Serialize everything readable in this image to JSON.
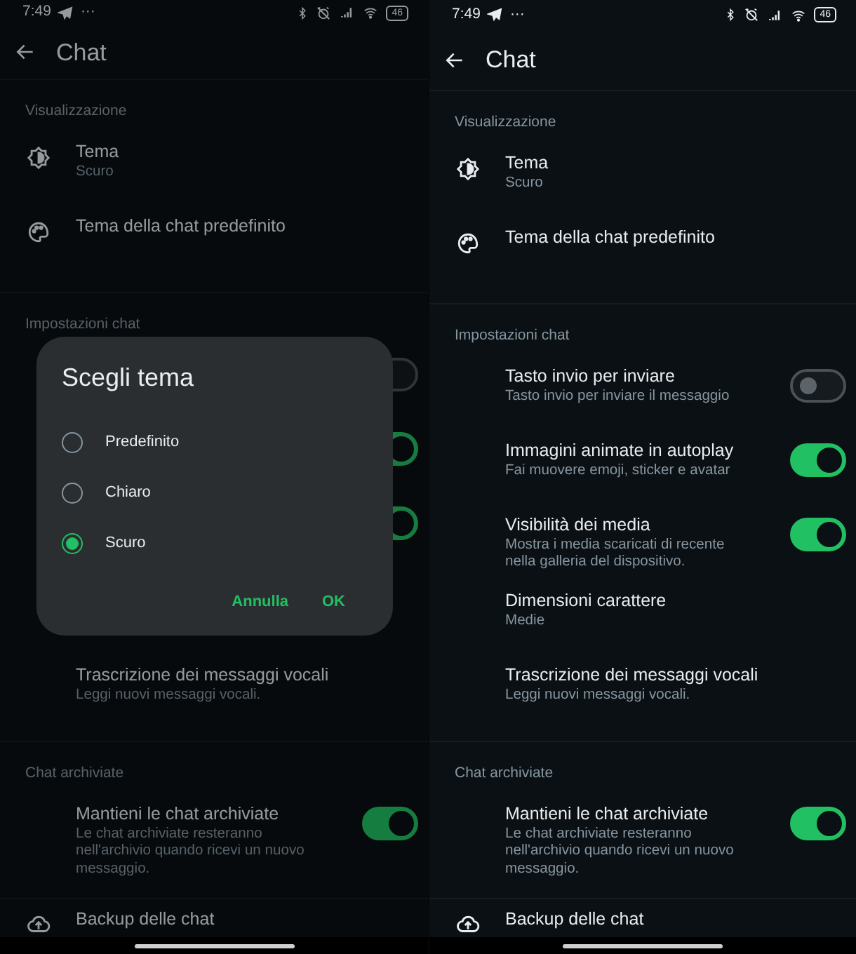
{
  "screens": [
    {
      "status_bar": {
        "time": "7:49",
        "more": "···",
        "battery": "46"
      },
      "title": "Chat",
      "sections": [
        {
          "header": "Visualizzazione",
          "items": [
            {
              "kind": "theme",
              "title": "Tema",
              "subtitle": "Scuro"
            },
            {
              "kind": "palette",
              "title": "Tema della chat predefinito"
            }
          ]
        },
        {
          "header": "Impostazioni chat",
          "items": [
            {
              "kind": "toggle",
              "on": false
            },
            {
              "kind": "toggle",
              "on": true
            },
            {
              "kind": "toggle",
              "on": true
            },
            {
              "kind": "text",
              "title": "Trascrizione dei messaggi vocali",
              "subtitle": "Leggi nuovi messaggi vocali."
            }
          ]
        },
        {
          "header": "Chat archiviate",
          "items": [
            {
              "kind": "toggle",
              "title": "Mantieni le chat archiviate",
              "subtitle": "Le chat archiviate resteranno nell'archivio quando ricevi un nuovo messaggio.",
              "on": true
            }
          ]
        },
        {
          "items": [
            {
              "kind": "backup",
              "title": "Backup delle chat"
            }
          ]
        }
      ],
      "dialog": {
        "title": "Scegli tema",
        "options": [
          {
            "label": "Predefinito",
            "selected": false
          },
          {
            "label": "Chiaro",
            "selected": false
          },
          {
            "label": "Scuro",
            "selected": true
          }
        ],
        "buttons": [
          "Annulla",
          "OK"
        ]
      }
    },
    {
      "status_bar": {
        "time": "7:49",
        "more": "···",
        "battery": "46"
      },
      "title": "Chat",
      "sections": [
        {
          "header": "Visualizzazione",
          "items": [
            {
              "kind": "theme",
              "title": "Tema",
              "subtitle": "Scuro"
            },
            {
              "kind": "palette",
              "title": "Tema della chat predefinito"
            }
          ]
        },
        {
          "header": "Impostazioni chat",
          "items": [
            {
              "kind": "toggle",
              "title": "Tasto invio per inviare",
              "subtitle": "Tasto invio per inviare il messaggio",
              "on": false
            },
            {
              "kind": "toggle",
              "title": "Immagini animate in autoplay",
              "subtitle": "Fai muovere emoji, sticker e avatar",
              "on": true
            },
            {
              "kind": "toggle",
              "title": "Visibilità dei media",
              "subtitle": "Mostra i media scaricati di recente nella galleria del dispositivo.",
              "on": true
            },
            {
              "kind": "text",
              "title": "Dimensioni carattere",
              "subtitle": "Medie"
            },
            {
              "kind": "text",
              "title": "Trascrizione dei messaggi vocali",
              "subtitle": "Leggi nuovi messaggi vocali."
            }
          ]
        },
        {
          "header": "Chat archiviate",
          "items": [
            {
              "kind": "toggle",
              "title": "Mantieni le chat archiviate",
              "subtitle": "Le chat archiviate resteranno nell'archivio quando ricevi un nuovo messaggio.",
              "on": true
            }
          ]
        },
        {
          "items": [
            {
              "kind": "backup",
              "title": "Backup delle chat"
            }
          ]
        }
      ]
    }
  ]
}
